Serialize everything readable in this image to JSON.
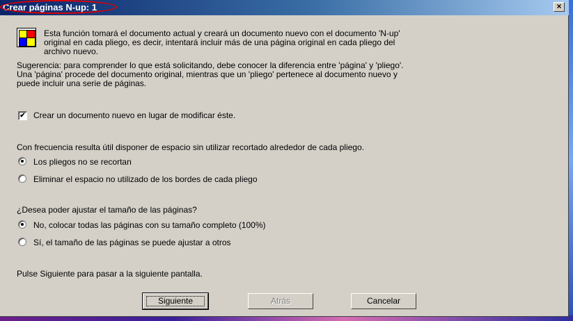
{
  "window": {
    "title": "Crear páginas N-up: 1",
    "close_label": "×"
  },
  "intro": {
    "line1": "Esta función tomará el documento actual y creará un documento nuevo con el documento 'N-up'",
    "line2": "original en cada pliego,  es decir, intentará incluir más de una página original en cada pliego del",
    "line3": "archivo nuevo."
  },
  "hint": {
    "line1": "Sugerencia: para comprender lo que está solicitando, debe conocer la diferencia entre 'página' y 'pliego'.",
    "line2": "Una 'página' procede del documento original, mientras que un 'pliego' pertenece al documento nuevo y",
    "line3": "puede incluir una serie de páginas."
  },
  "new_document_checkbox": {
    "label": "Crear un documento nuevo en lugar de modificar éste.",
    "checked": true,
    "check_glyph": "✔"
  },
  "crop_section": {
    "question": "Con frecuencia resulta útil disponer de espacio sin utilizar recortado alrededor de cada pliego.",
    "options": [
      {
        "label": "Los pliegos no se recortan",
        "selected": true
      },
      {
        "label": "Eliminar el espacio no utilizado de los bordes de cada pliego",
        "selected": false
      }
    ]
  },
  "scale_section": {
    "question": "¿Desea poder ajustar el tamaño de las páginas?",
    "options": [
      {
        "label": "No, colocar todas las páginas con su tamaño completo (100%)",
        "selected": true
      },
      {
        "label": "Sí, el tamaño de las páginas se puede ajustar a otros",
        "selected": false
      }
    ]
  },
  "footer_hint": "Pulse Siguiente para pasar a la siguiente pantalla.",
  "buttons": {
    "next": "Siguiente",
    "back": "Atrás",
    "cancel": "Cancelar"
  },
  "colors": {
    "dialog_bg": "#d4d0c8",
    "titlebar_start": "#0a246a",
    "titlebar_end": "#a6caf0",
    "highlight": "#e00000"
  },
  "icons": {
    "app": "nup-layout-icon",
    "close": "close-icon"
  }
}
